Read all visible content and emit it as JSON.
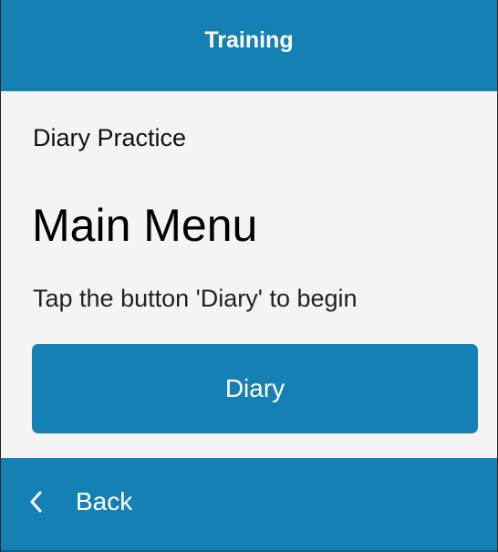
{
  "header": {
    "title": "Training"
  },
  "main": {
    "subtitle": "Diary Practice",
    "title": "Main Menu",
    "instructions": "Tap the button 'Diary' to begin",
    "diary_button_label": "Diary"
  },
  "footer": {
    "back_label": "Back",
    "back_icon": "chevron-left-icon"
  },
  "colors": {
    "accent": "#1580b3",
    "background": "#f4f4f4",
    "text": "#000000"
  }
}
